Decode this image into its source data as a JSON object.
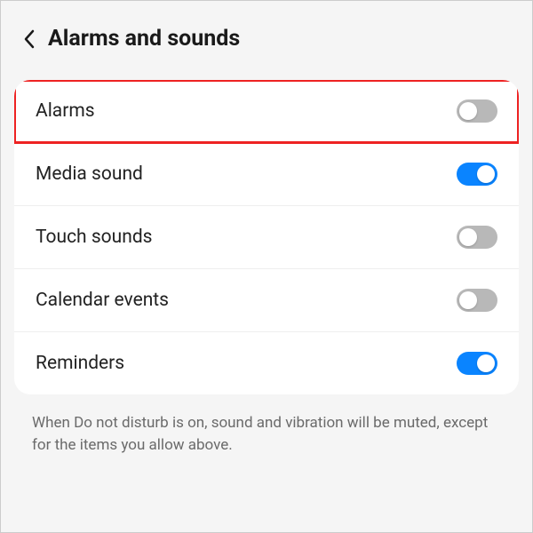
{
  "header": {
    "title": "Alarms and sounds"
  },
  "settings": {
    "items": [
      {
        "label": "Alarms",
        "enabled": false,
        "highlighted": true
      },
      {
        "label": "Media sound",
        "enabled": true,
        "highlighted": false
      },
      {
        "label": "Touch sounds",
        "enabled": false,
        "highlighted": false
      },
      {
        "label": "Calendar events",
        "enabled": false,
        "highlighted": false
      },
      {
        "label": "Reminders",
        "enabled": true,
        "highlighted": false
      }
    ]
  },
  "footer": {
    "text": "When Do not disturb is on, sound and vibration will be muted, except for the items you allow above."
  },
  "colors": {
    "accent": "#0a84ff",
    "highlight_border": "#ee2222"
  }
}
